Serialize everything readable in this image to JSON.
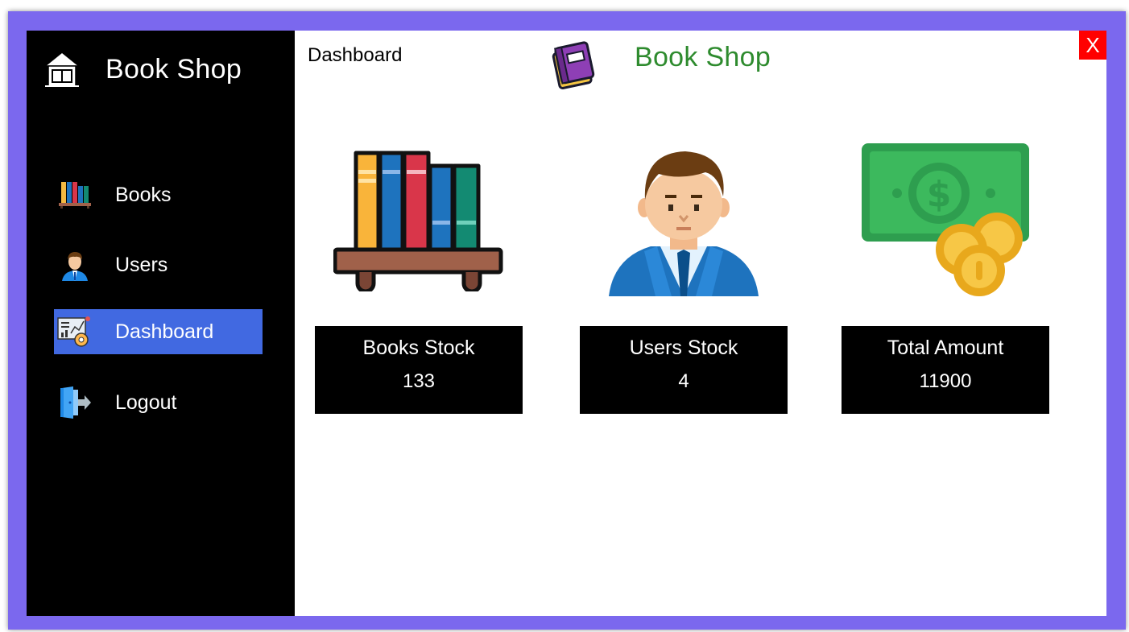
{
  "window": {
    "close_label": "X",
    "frame_color": "#7b68ee"
  },
  "sidebar": {
    "brand_title": "Book Shop",
    "brand_icon": "house-book-icon",
    "items": [
      {
        "label": "Books",
        "icon": "bookshelf-icon",
        "active": false
      },
      {
        "label": "Users",
        "icon": "user-icon",
        "active": false
      },
      {
        "label": "Dashboard",
        "icon": "dashboard-chart-icon",
        "active": true
      },
      {
        "label": "Logout",
        "icon": "logout-door-icon",
        "active": false
      }
    ],
    "active_color": "#4169e1"
  },
  "header": {
    "page_label": "Dashboard",
    "title": "Book Shop",
    "title_color": "#2e8b2e",
    "icon": "book-icon"
  },
  "stats": [
    {
      "label": "Books Stock",
      "value": "133",
      "illustration": "bookshelf-illustration"
    },
    {
      "label": "Users Stock",
      "value": "4",
      "illustration": "businessman-illustration"
    },
    {
      "label": "Total Amount",
      "value": "11900",
      "illustration": "money-coins-illustration"
    }
  ]
}
